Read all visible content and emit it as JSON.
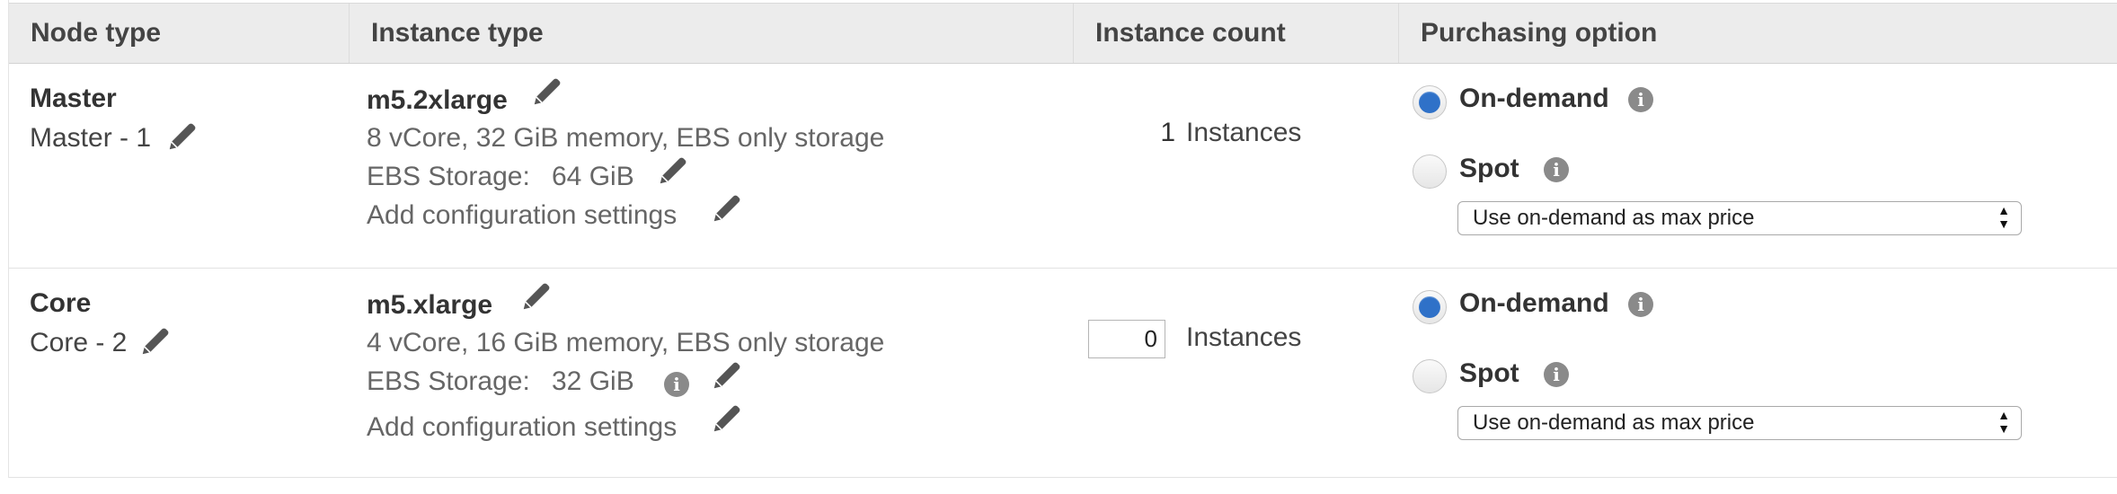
{
  "headers": {
    "node_type": "Node type",
    "instance_type": "Instance type",
    "instance_count": "Instance count",
    "purchasing_option": "Purchasing option"
  },
  "rows": [
    {
      "node_title": "Master",
      "node_sub": "Master - 1",
      "instance_type": "m5.2xlarge",
      "spec": "8 vCore, 32 GiB memory, EBS only storage",
      "ebs_label": "EBS Storage:",
      "ebs_value": "64 GiB",
      "config_link": "Add configuration settings",
      "count": "1",
      "count_editable": false,
      "instances_label": "Instances",
      "ondemand_label": "On-demand",
      "spot_label": "Spot",
      "selected_option": "On-demand",
      "max_price_select": "Use on-demand as max price"
    },
    {
      "node_title": "Core",
      "node_sub": "Core - 2",
      "instance_type": "m5.xlarge",
      "spec": "4 vCore, 16 GiB memory, EBS only storage",
      "ebs_label": "EBS Storage:",
      "ebs_value": "32 GiB",
      "config_link": "Add configuration settings",
      "count": "0",
      "count_editable": true,
      "instances_label": "Instances",
      "ondemand_label": "On-demand",
      "spot_label": "Spot",
      "selected_option": "On-demand",
      "max_price_select": "Use on-demand as max price"
    }
  ],
  "icons": {
    "edit": "pencil-icon",
    "info": "info-icon",
    "select_arrows": "up-down-arrows-icon"
  },
  "colors": {
    "radio_selected": "#2f71c8",
    "header_bg": "#ececec",
    "muted_text": "#666666"
  }
}
